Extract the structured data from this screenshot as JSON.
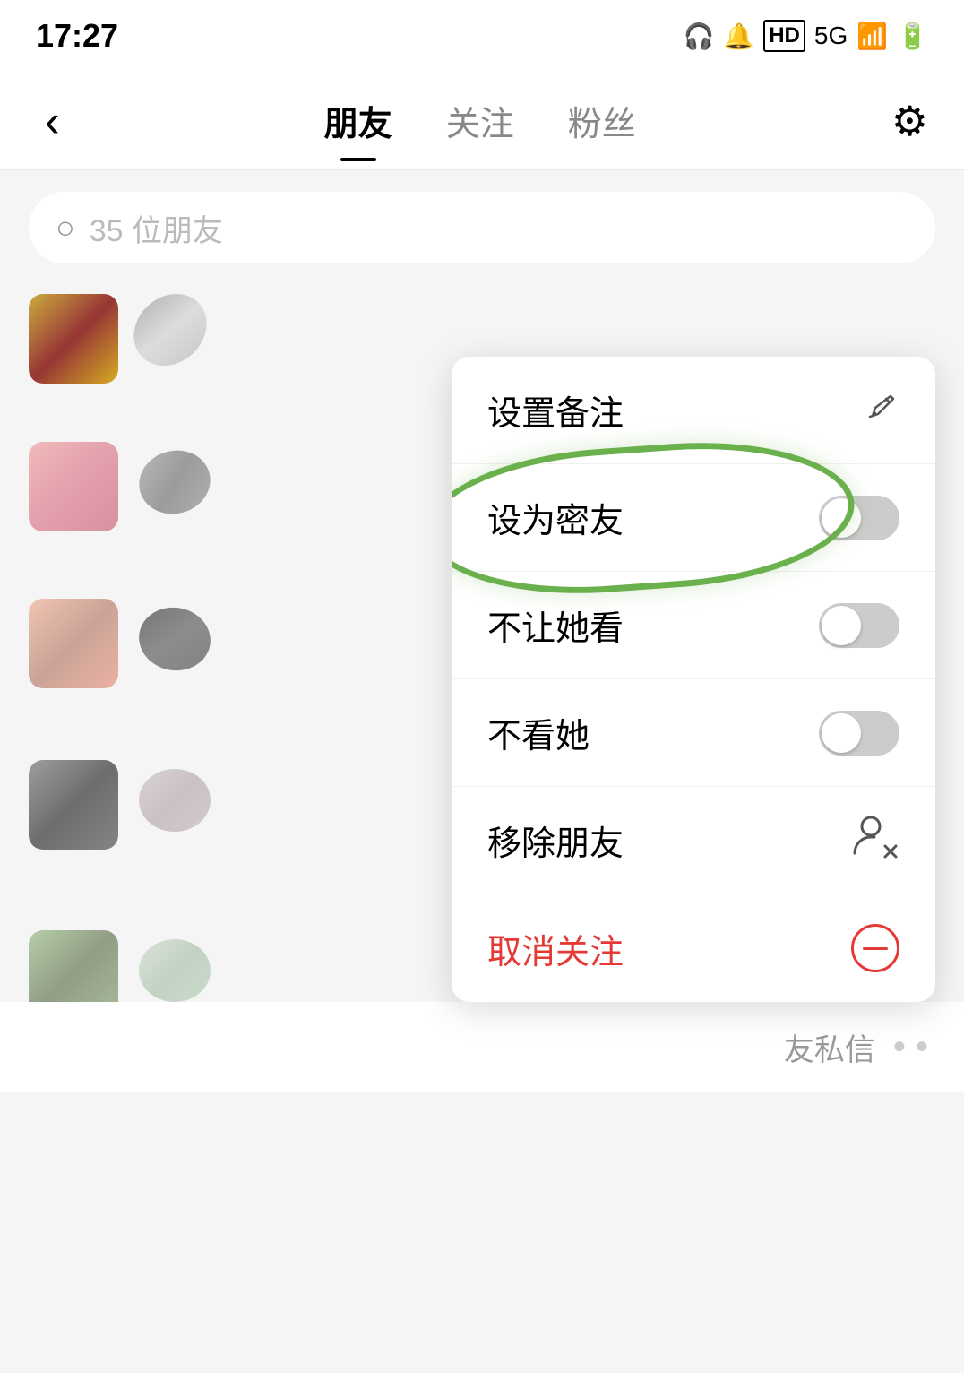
{
  "statusBar": {
    "time": "17:27",
    "icons": [
      "headphone",
      "bell-muted",
      "hd",
      "5g",
      "signal",
      "wifi",
      "battery"
    ]
  },
  "navBar": {
    "backLabel": "‹",
    "tabs": [
      {
        "label": "朋友",
        "active": true
      },
      {
        "label": "关注",
        "active": false
      },
      {
        "label": "粉丝",
        "active": false
      }
    ],
    "settingsLabel": "⚙"
  },
  "searchBar": {
    "placeholder": "35 位朋友",
    "icon": "○"
  },
  "contextMenu": {
    "items": [
      {
        "id": "set-note",
        "label": "设置备注",
        "iconType": "pencil"
      },
      {
        "id": "close-friend",
        "label": "设为密友",
        "iconType": "toggle"
      },
      {
        "id": "hide-from-her",
        "label": "不让她看",
        "iconType": "toggle"
      },
      {
        "id": "hide-her",
        "label": "不看她",
        "iconType": "toggle"
      },
      {
        "id": "remove-friend",
        "label": "移除朋友",
        "iconType": "remove-user"
      },
      {
        "id": "unfollow",
        "label": "取消关注",
        "iconType": "minus-circle",
        "red": true
      }
    ]
  },
  "bottomBar": {
    "partialText": "友私信",
    "dots": "• •"
  }
}
